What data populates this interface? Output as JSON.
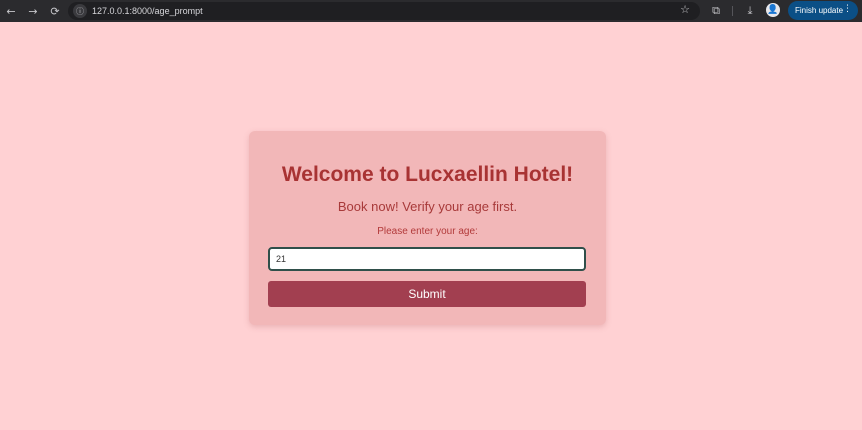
{
  "browser": {
    "back_icon": "←",
    "forward_icon": "→",
    "reload_icon": "⟳",
    "site_info_icon": "ⓘ",
    "url": "127.0.0.1:8000/age_prompt",
    "bookmark_icon": "☆",
    "extensions_icon": "⧉",
    "download_icon": "⤓",
    "profile_icon": "👤",
    "update_label": "Finish update",
    "menu_icon": "⋮"
  },
  "card": {
    "title": "Welcome to Lucxaellin Hotel!",
    "subtitle": "Book now! Verify your age first.",
    "prompt": "Please enter your age:",
    "age_value": "21",
    "submit_label": "Submit"
  },
  "colors": {
    "page_background": "#ffd1d3",
    "card_background": "#f2b7b8",
    "title_color": "#a83333",
    "submit_background": "#a23f50",
    "update_button": "#0b4f86"
  }
}
